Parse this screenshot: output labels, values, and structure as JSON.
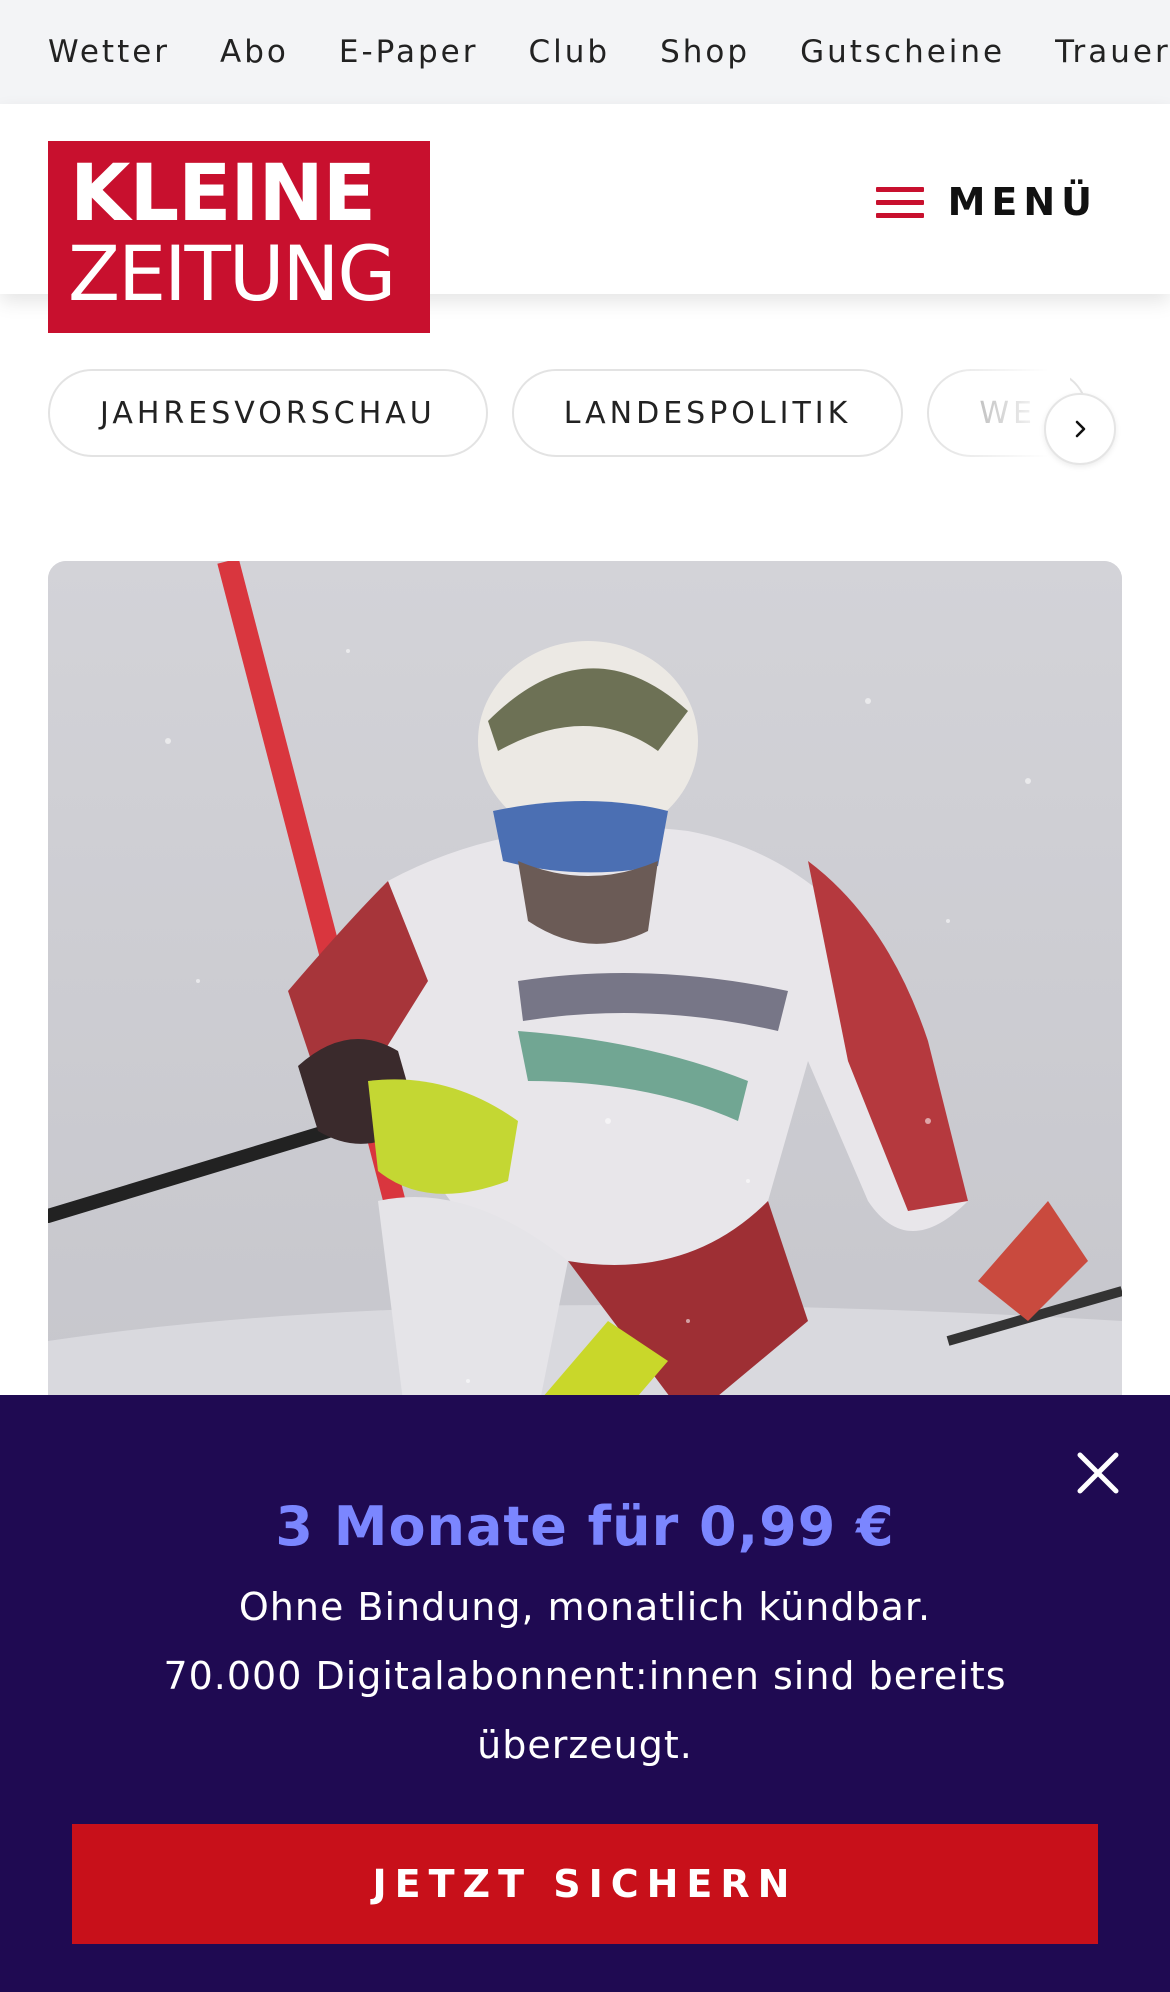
{
  "topnav": {
    "items": [
      "Wetter",
      "Abo",
      "E-Paper",
      "Club",
      "Shop",
      "Gutscheine",
      "Trauerp"
    ]
  },
  "header": {
    "logo_line1": "KLEINE",
    "logo_line2": "ZEITUNG",
    "menu_label": "MENÜ",
    "brand_color": "#c8102e"
  },
  "chips": {
    "items": [
      "JAHRESVORSCHAU",
      "LANDESPOLITIK",
      "WE"
    ],
    "next_icon": "chevron-right-icon"
  },
  "hero": {
    "icon": "hero-photo"
  },
  "offer": {
    "title": "3 Monate für 0,99 €",
    "line1": "Ohne Bindung, monatlich kündbar.",
    "line2": "70.000 Digitalabonnent:innen sind bereits überzeugt.",
    "cta_label": "JETZT SICHERN",
    "close_icon": "close-icon",
    "background_color": "#1f0a52",
    "title_color": "#7b86ff",
    "cta_color": "#c8101a"
  }
}
